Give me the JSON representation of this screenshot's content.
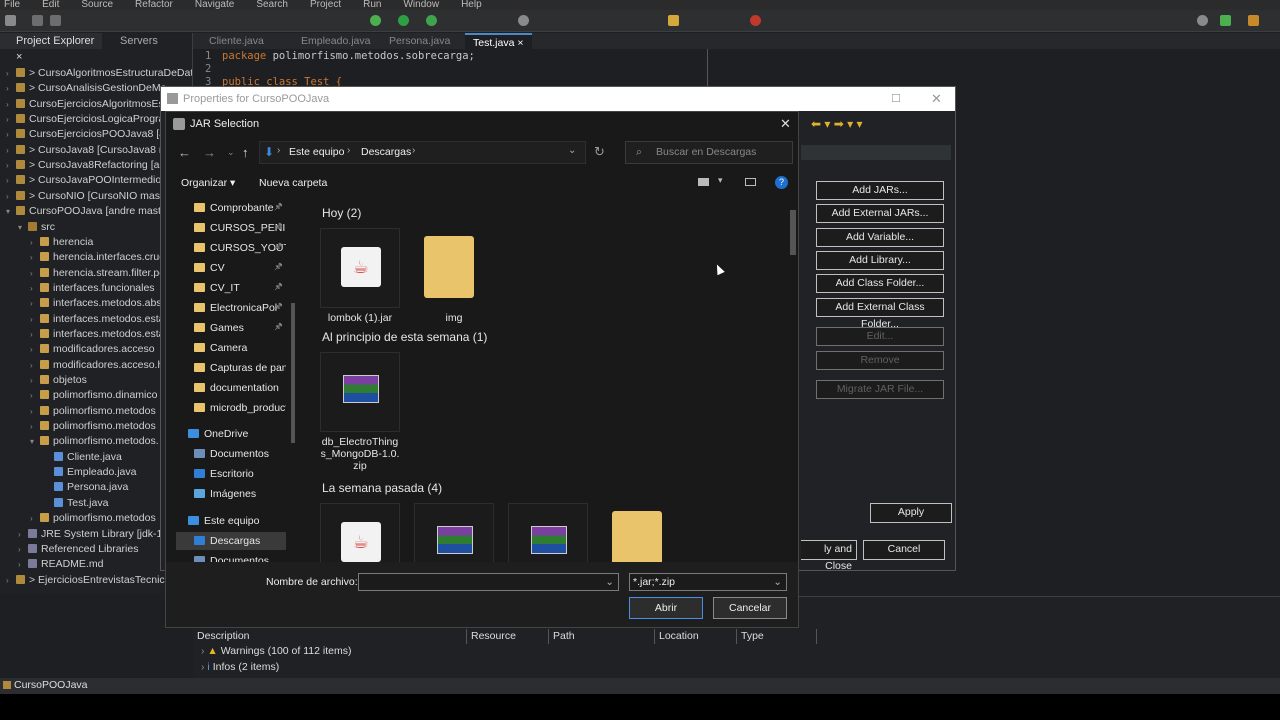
{
  "menubar": [
    "File",
    "Edit",
    "Source",
    "Refactor",
    "Navigate",
    "Search",
    "Project",
    "Run",
    "Window",
    "Help"
  ],
  "views": {
    "project_explorer": "Project Explorer",
    "servers": "Servers"
  },
  "explorer_tree": [
    {
      "label": "> CursoAlgoritmosEstructuraDeDatc",
      "type": "proj"
    },
    {
      "label": "> CursoAnalisisGestionDeMe",
      "type": "proj"
    },
    {
      "label": "CursoEjerciciosAlgoritmosEst",
      "type": "proj"
    },
    {
      "label": "CursoEjerciciosLogicaProgran",
      "type": "proj"
    },
    {
      "label": "CursoEjerciciosPOOJava8 [anc",
      "type": "proj"
    },
    {
      "label": "> CursoJava8 [CursoJava8 ma",
      "type": "proj"
    },
    {
      "label": "> CursoJava8Refactoring [anc",
      "type": "proj"
    },
    {
      "label": "> CursoJavaPOOIntermedio [",
      "type": "proj"
    },
    {
      "label": "> CursoNIO [CursoNIO maste",
      "type": "proj"
    },
    {
      "label": "CursoPOOJava [andre master",
      "type": "proj"
    },
    {
      "label": "src",
      "type": "srcf"
    },
    {
      "label": "herencia",
      "type": "pkg"
    },
    {
      "label": "herencia.interfaces.crud",
      "type": "pkg"
    },
    {
      "label": "herencia.stream.filter.pe",
      "type": "pkg"
    },
    {
      "label": "interfaces.funcionales",
      "type": "pkg"
    },
    {
      "label": "interfaces.metodos.abs",
      "type": "pkg"
    },
    {
      "label": "interfaces.metodos.esta",
      "type": "pkg"
    },
    {
      "label": "interfaces.metodos.esta",
      "type": "pkg"
    },
    {
      "label": "modificadores.acceso",
      "type": "pkg"
    },
    {
      "label": "modificadores.acceso.h",
      "type": "pkg"
    },
    {
      "label": "objetos",
      "type": "pkg"
    },
    {
      "label": "polimorfismo.dinamico",
      "type": "pkg"
    },
    {
      "label": "polimorfismo.metodos",
      "type": "pkg"
    },
    {
      "label": "polimorfismo.metodos",
      "type": "pkg"
    },
    {
      "label": "polimorfismo.metodos.",
      "type": "pkg"
    },
    {
      "label": "Cliente.java",
      "type": "jfile"
    },
    {
      "label": "Empleado.java",
      "type": "jfile"
    },
    {
      "label": "Persona.java",
      "type": "jfile"
    },
    {
      "label": "Test.java",
      "type": "jfile"
    },
    {
      "label": "polimorfismo.metodos",
      "type": "pkg"
    },
    {
      "label": "JRE System Library [jdk-12",
      "type": "lib"
    },
    {
      "label": "Referenced Libraries",
      "type": "lib"
    },
    {
      "label": "README.md",
      "type": "lib"
    },
    {
      "label": "> EjerciciosEntrevistasTecnicas",
      "type": "proj"
    }
  ],
  "editor_tabs": [
    "Cliente.java",
    "Empleado.java",
    "Persona.java",
    "Test.java"
  ],
  "code": {
    "ln1": "1",
    "line1_kw": "package",
    "line1_rest": " polimorfismo.metodos.sobrecarga;",
    "ln2": "2",
    "ln3": "3",
    "line3": "public class Test {"
  },
  "properties_dialog": {
    "title": "Properties for CursoPOOJava",
    "buttons": [
      {
        "label": "Add JARs...",
        "enabled": true
      },
      {
        "label": "Add External JARs...",
        "enabled": true
      },
      {
        "label": "Add Variable...",
        "enabled": true
      },
      {
        "label": "Add Library...",
        "enabled": true
      },
      {
        "label": "Add Class Folder...",
        "enabled": true
      },
      {
        "label": "Add External Class Folder...",
        "enabled": true
      },
      {
        "label": "Edit...",
        "enabled": false
      },
      {
        "label": "Remove",
        "enabled": false
      },
      {
        "label": "Migrate JAR File...",
        "enabled": false
      }
    ],
    "apply": "Apply",
    "apply_close": "ly and Close",
    "cancel": "Cancel"
  },
  "jar_dialog": {
    "title": "JAR Selection",
    "breadcrumb": [
      "Este equipo",
      "Descargas"
    ],
    "search_placeholder": "Buscar en Descargas",
    "organize": "Organizar",
    "new_folder": "Nueva carpeta",
    "nav_items": [
      {
        "label": "Comprobante",
        "pinned": true,
        "type": "folder"
      },
      {
        "label": "CURSOS_PENI",
        "pinned": true,
        "type": "folder"
      },
      {
        "label": "CURSOS_YOUT",
        "pinned": true,
        "type": "folder"
      },
      {
        "label": "CV",
        "pinned": true,
        "type": "folder"
      },
      {
        "label": "CV_IT",
        "pinned": true,
        "type": "folder"
      },
      {
        "label": "ElectronicaPol",
        "pinned": true,
        "type": "folder"
      },
      {
        "label": "Games",
        "pinned": true,
        "type": "folder"
      },
      {
        "label": "Camera",
        "pinned": false,
        "type": "folder"
      },
      {
        "label": "Capturas de pant",
        "pinned": false,
        "type": "folder"
      },
      {
        "label": "documentation",
        "pinned": false,
        "type": "folder"
      },
      {
        "label": "microdb_product",
        "pinned": false,
        "type": "folder"
      }
    ],
    "nav_groups": [
      {
        "label": "OneDrive"
      },
      {
        "label": "Documentos"
      },
      {
        "label": "Escritorio"
      },
      {
        "label": "Imágenes"
      },
      {
        "label": "Este equipo"
      },
      {
        "label": "Descargas"
      },
      {
        "label": "Documentos"
      }
    ],
    "groups": [
      {
        "title": "Hoy (2)",
        "files": [
          {
            "name": "lombok (1).jar",
            "kind": "jar"
          },
          {
            "name": "img",
            "kind": "folder"
          }
        ]
      },
      {
        "title": "Al principio de esta semana (1)",
        "files": [
          {
            "name": "db_ElectroThings_MongoDB-1.0.zip",
            "kind": "zip"
          }
        ]
      },
      {
        "title": "La semana pasada (4)",
        "files": [
          {
            "name": "",
            "kind": "jar"
          },
          {
            "name": "",
            "kind": "zip"
          },
          {
            "name": "",
            "kind": "zip"
          },
          {
            "name": "",
            "kind": "folder"
          }
        ]
      }
    ],
    "file_name_label": "Nombre de archivo:",
    "file_name_value": "",
    "filter": "*.jar;*.zip",
    "open": "Abrir",
    "cancel": "Cancelar"
  },
  "problems": {
    "columns": [
      "Description",
      "Resource",
      "Path",
      "Location",
      "Type"
    ],
    "rows": [
      "Warnings (100 of 112 items)",
      "Infos (2 items)"
    ]
  },
  "status": "CursoPOOJava",
  "colors": {
    "accent": "#0078d7",
    "folder": "#e9c46a"
  }
}
